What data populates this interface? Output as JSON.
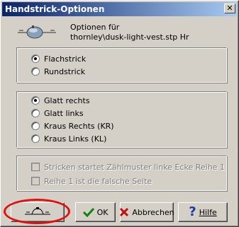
{
  "window": {
    "title": "Handstrick-Optionen"
  },
  "header": {
    "icon": "knitting-machine-icon",
    "line1": "Optionen für",
    "line2": "thornley\\dusk-light-vest.stp Hr"
  },
  "stitch_type": {
    "options": [
      {
        "label": "Flachstrick",
        "selected": true
      },
      {
        "label": "Rundstrick",
        "selected": false
      }
    ]
  },
  "stitch_style": {
    "options": [
      {
        "label": "Glatt rechts",
        "selected": true
      },
      {
        "label": "Glatt links",
        "selected": false
      },
      {
        "label": "Kraus Rechts (KR)",
        "selected": false
      },
      {
        "label": "Kraus Links (KL)",
        "selected": false
      }
    ]
  },
  "pattern_options": {
    "checkboxes": [
      {
        "label": "Stricken startet Zählmuster linke Ecke Reihe 1",
        "checked": false,
        "enabled": false
      },
      {
        "label": "Reihe 1 ist die falsche Seite",
        "checked": false,
        "enabled": false
      }
    ]
  },
  "buttons": {
    "machine": {
      "icon": "knitting-machine-icon"
    },
    "ok": {
      "label": "OK",
      "icon": "checkmark-icon"
    },
    "cancel": {
      "label": "Abbrechen",
      "icon": "x-icon"
    },
    "help": {
      "label": "Hilfe",
      "icon": "question-mark-icon"
    }
  },
  "colors": {
    "titlebar_start": "#0a246a",
    "titlebar_end": "#a6caf0",
    "highlight_ellipse": "#e01010"
  }
}
